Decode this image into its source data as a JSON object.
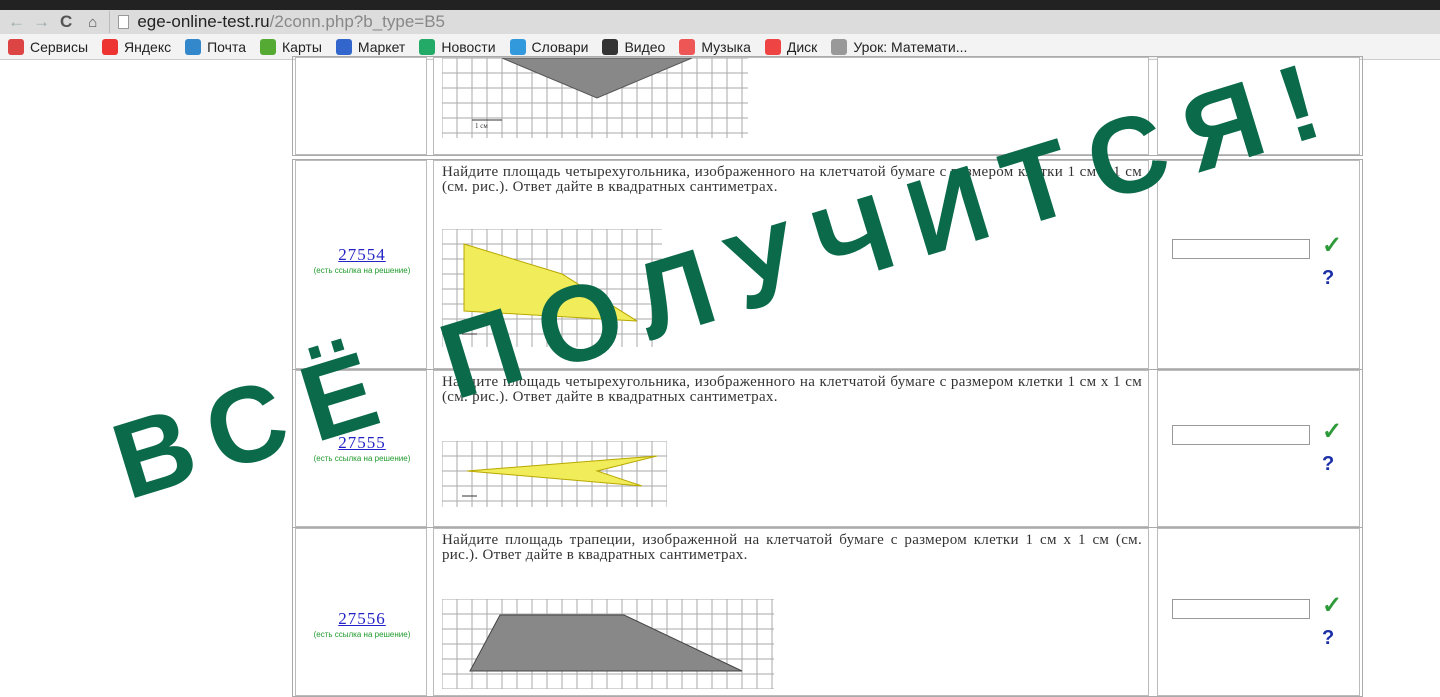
{
  "browser": {
    "url_host": "ege-online-test.ru",
    "url_path": "/2conn.php?b_type=B5",
    "bookmarks": [
      {
        "label": "Сервисы",
        "icon": "apps-icon",
        "color": "#d44"
      },
      {
        "label": "Яндекс",
        "icon": "yandex-icon",
        "color": "#e33"
      },
      {
        "label": "Почта",
        "icon": "mail-icon",
        "color": "#38c"
      },
      {
        "label": "Карты",
        "icon": "maps-icon",
        "color": "#5a3"
      },
      {
        "label": "Маркет",
        "icon": "market-icon",
        "color": "#36c"
      },
      {
        "label": "Новости",
        "icon": "news-icon",
        "color": "#2a6"
      },
      {
        "label": "Словари",
        "icon": "dictionary-icon",
        "color": "#39d"
      },
      {
        "label": "Видео",
        "icon": "video-icon",
        "color": "#333"
      },
      {
        "label": "Музыка",
        "icon": "music-icon",
        "color": "#e55"
      },
      {
        "label": "Диск",
        "icon": "disk-icon",
        "color": "#e44"
      },
      {
        "label": "Урок: Математи...",
        "icon": "page-icon",
        "color": "#999"
      }
    ]
  },
  "problems": [
    {
      "scale_label": "1 см"
    },
    {
      "id": "27554",
      "note": "(есть ссылка на решение)",
      "text": "Найдите площадь четырехугольника, изображенного на клетчатой бумаге с размером клетки 1 см х 1 см (см. рис.). Ответ дайте в квадратных сантиметрах.",
      "fill": "#f0ec5a"
    },
    {
      "id": "27555",
      "note": "(есть ссылка на решение)",
      "text": "Найдите площадь четырехугольника, изображенного на клетчатой бумаге с размером клетки 1 см х 1 см (см. рис.). Ответ дайте в квадратных сантиметрах.",
      "fill": "#f0ec5a"
    },
    {
      "id": "27556",
      "note": "(есть ссылка на решение)",
      "text": "Найдите площадь трапеции, изображенной на клетчатой бумаге с размером клетки 1 см х 1 см (см. рис.). Ответ дайте в квадратных сантиметрах.",
      "fill": "#888888"
    }
  ],
  "icons": {
    "check": "✓",
    "help": "?"
  },
  "overlay": {
    "text": "ВСЁ ПОЛУЧИТСЯ!",
    "color": "#0a6a4a"
  }
}
